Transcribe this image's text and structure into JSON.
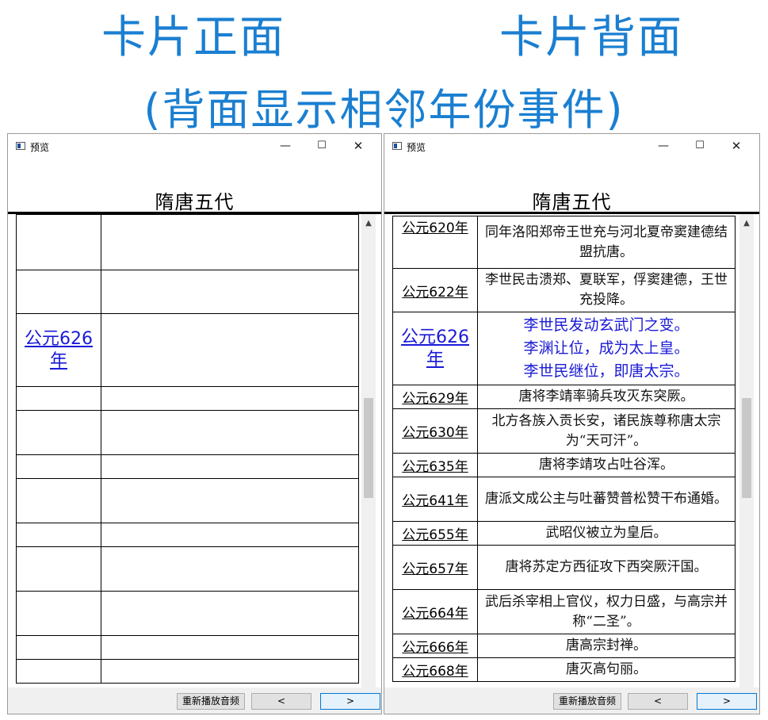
{
  "headline": {
    "front": "卡片正面",
    "back": "卡片背面",
    "subtitle": "(背面显示相邻年份事件)"
  },
  "window": {
    "title": "预览",
    "minimize": "—",
    "maximize": "☐",
    "close": "✕",
    "header_title": "隋唐五代",
    "scroll_up": "▲"
  },
  "front": {
    "year": "公元626年",
    "row_count": 12
  },
  "back": {
    "rows": [
      {
        "year": "公元620年",
        "event": "同年洛阳郑帝王世充与河北夏帝窦建德结盟抗唐。"
      },
      {
        "year": "公元622年",
        "event": "李世民击溃郑、夏联军，俘窦建德，王世充投降。"
      },
      {
        "year": "公元626年",
        "event_lines": [
          "李世民发动玄武门之变。",
          "李渊让位，成为太上皇。",
          "李世民继位，即唐太宗。"
        ]
      },
      {
        "year": "公元629年",
        "event": "唐将李靖率骑兵攻灭东突厥。"
      },
      {
        "year": "公元630年",
        "event": "北方各族入贡长安，诸民族尊称唐太宗为“天可汗”。"
      },
      {
        "year": "公元635年",
        "event": "唐将李靖攻占吐谷浑。"
      },
      {
        "year": "公元641年",
        "event": "唐派文成公主与吐蕃赞普松赞干布通婚。"
      },
      {
        "year": "公元655年",
        "event": "武昭仪被立为皇后。"
      },
      {
        "year": "公元657年",
        "event": "唐将苏定方西征攻下西突厥汗国。"
      },
      {
        "year": "公元664年",
        "event": "武后杀宰相上官仪，权力日盛，与高宗并称“二圣”。"
      },
      {
        "year": "公元666年",
        "event": "唐高宗封禅。"
      },
      {
        "year": "公元668年",
        "event": "唐灭高句丽。"
      }
    ]
  },
  "buttons": {
    "replay": "重新播放音频",
    "prev": "<",
    "next": ">"
  }
}
